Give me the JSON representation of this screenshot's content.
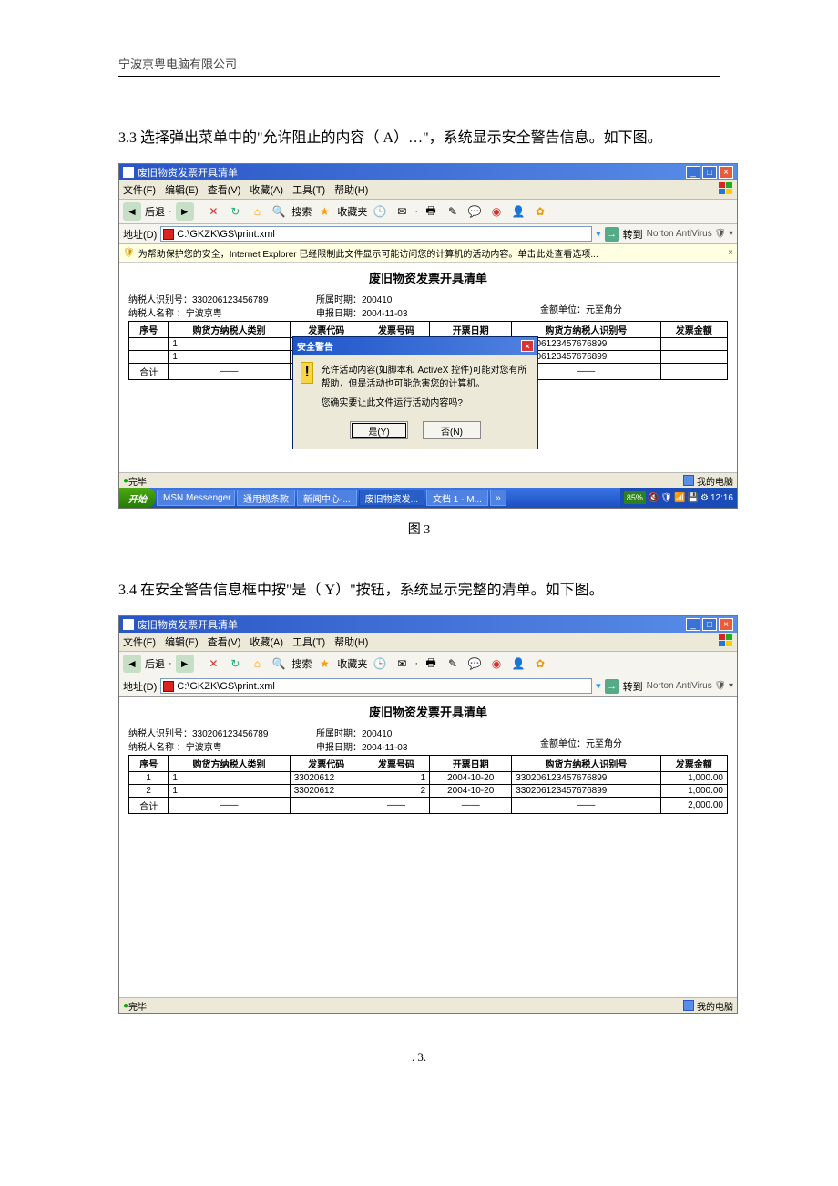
{
  "doc": {
    "company": "宁波京粤电脑有限公司",
    "para1": "3.3 选择弹出菜单中的\"允许阻止的内容（    A）…\"，系统显示安全警告信息。如下图。",
    "caption1": "图 3",
    "para2": "3.4 在安全警告信息框中按\"是（  Y）\"按钮，系统显示完整的清单。如下图。",
    "page_num": ". 3."
  },
  "win": {
    "title": "废旧物资发票开具清单",
    "menus": [
      "文件(F)",
      "编辑(E)",
      "查看(V)",
      "收藏(A)",
      "工具(T)",
      "帮助(H)"
    ],
    "back_label": "后退",
    "search_label": "搜索",
    "fav_label": "收藏夹",
    "addr_label": "地址(D)",
    "addr_value": "C:\\GKZK\\GS\\print.xml",
    "go_label": "转到",
    "antivirus": "Norton AntiVirus",
    "infobar": "为帮助保护您的安全，Internet Explorer 已经限制此文件显示可能访问您的计算机的活动内容。单击此处查看选项...",
    "status_done": "完毕",
    "status_mycomputer": "我的电脑"
  },
  "page": {
    "title": "废旧物资发票开具清单",
    "meta": {
      "taxid_label": "纳税人识别号：",
      "taxid": "330206123456789",
      "taxname_label": "纳税人名称  ：",
      "taxname": "宁波京粤",
      "period_label": "所属时期：",
      "period": "200410",
      "rptdate_label": "申报日期：",
      "rptdate": "2004-11-03",
      "unit_label": "金额单位：元至角分"
    },
    "headers": [
      "序号",
      "购货方纳税人类别",
      "发票代码",
      "发票号码",
      "开票日期",
      "购货方纳税人识别号",
      "发票金额"
    ],
    "rows_fig3": [
      {
        "no": "",
        "cat": "1",
        "code": "33020612",
        "num": "1",
        "date": "2004-10-20",
        "buyer": "330206123457676899",
        "amt": ""
      },
      {
        "no": "",
        "cat": "1",
        "code": "33020612",
        "num": "2",
        "date": "2004-10-20",
        "buyer": "330206123457676899",
        "amt": ""
      }
    ],
    "rows_fig4": [
      {
        "no": "1",
        "cat": "1",
        "code": "33020612",
        "num": "1",
        "date": "2004-10-20",
        "buyer": "330206123457676899",
        "amt": "1,000.00"
      },
      {
        "no": "2",
        "cat": "1",
        "code": "33020612",
        "num": "2",
        "date": "2004-10-20",
        "buyer": "330206123457676899",
        "amt": "1,000.00"
      }
    ],
    "sum_label": "合计",
    "dash": "——",
    "sum_amt_fig4": "2,000.00"
  },
  "dialog": {
    "title": "安全警告",
    "line1": "允许活动内容(如脚本和 ActiveX 控件)可能对您有所帮助，但是活动也可能危害您的计算机。",
    "line2": "您确实要让此文件运行活动内容吗?",
    "yes": "是(Y)",
    "no": "否(N)"
  },
  "taskbar": {
    "start": "开始",
    "items": [
      "MSN Messenger",
      "通用规条款",
      "新闻中心-...",
      "废旧物资发...",
      "文档 1 - M..."
    ],
    "battery": "85%",
    "clock": "12:16"
  }
}
